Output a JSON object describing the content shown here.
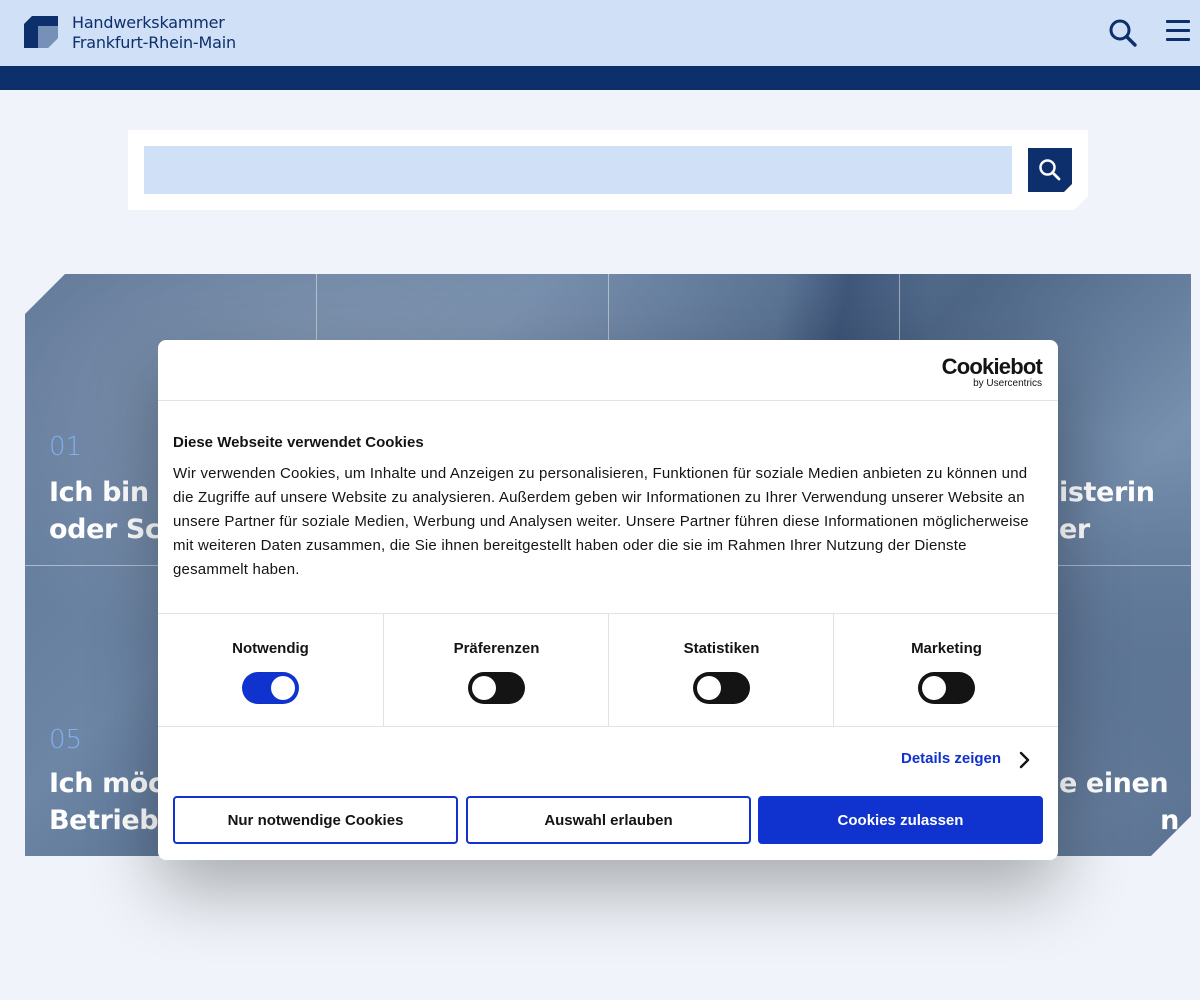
{
  "header": {
    "org_name_line1": "Handwerkskammer",
    "org_name_line2": "Frankfurt-Rhein-Main",
    "colors": {
      "primary": "#0d2f6b",
      "header_bg": "#cfe0f7"
    }
  },
  "search": {
    "value": "",
    "placeholder": ""
  },
  "tiles": [
    {
      "number": "01",
      "line1": "Ich bin Sc",
      "line2": "oder Schu"
    },
    {
      "number": "",
      "line1": "isterin",
      "line2": "er"
    },
    {
      "number": "05",
      "line1": "Ich möch",
      "line2": "Betrieb g"
    },
    {
      "number": "",
      "line1": "e einen",
      "line2": "n"
    }
  ],
  "cookie_banner": {
    "brand": "Cookiebot",
    "brand_sub": "by Usercentrics",
    "title": "Diese Webseite verwendet Cookies",
    "text": "Wir verwenden Cookies, um Inhalte und Anzeigen zu personalisieren, Funktionen für soziale Medien anbieten zu können und die Zugriffe auf unsere Website zu analysieren. Außerdem geben wir Informationen zu Ihrer Verwendung unserer Website an unsere Partner für soziale Medien, Werbung und Analysen weiter. Unsere Partner führen diese Informationen möglicherweise mit weiteren Daten zusammen, die Sie ihnen bereitgestellt haben oder die sie im Rahmen Ihrer Nutzung der Dienste gesammelt haben.",
    "categories": [
      {
        "label": "Notwendig",
        "enabled": true
      },
      {
        "label": "Präferenzen",
        "enabled": false
      },
      {
        "label": "Statistiken",
        "enabled": false
      },
      {
        "label": "Marketing",
        "enabled": false
      }
    ],
    "details_label": "Details zeigen",
    "buttons": {
      "necessary_only": "Nur notwendige Cookies",
      "allow_selection": "Auswahl erlauben",
      "allow_all": "Cookies zulassen"
    },
    "colors": {
      "accent": "#1032cf",
      "toggle_off": "#141414"
    }
  }
}
